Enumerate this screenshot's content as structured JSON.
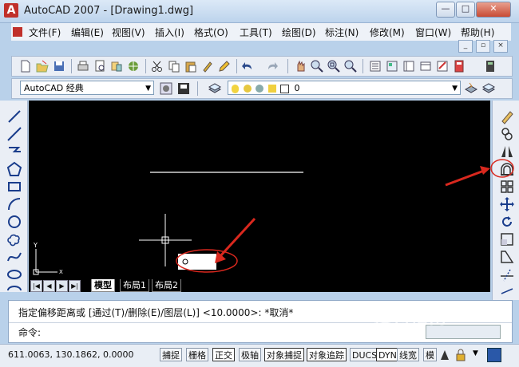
{
  "window": {
    "title": "AutoCAD 2007 - [Drawing1.dwg]",
    "logo_glyph": "A",
    "minimize_label": "—",
    "maximize_label": "□",
    "close_label": "✕"
  },
  "menu": {
    "items": [
      {
        "label": "文件(F)"
      },
      {
        "label": "编辑(E)"
      },
      {
        "label": "视图(V)"
      },
      {
        "label": "插入(I)"
      },
      {
        "label": "格式(O)"
      },
      {
        "label": "工具(T)"
      },
      {
        "label": "绘图(D)"
      },
      {
        "label": "标注(N)"
      },
      {
        "label": "修改(M)"
      },
      {
        "label": "窗口(W)"
      },
      {
        "label": "帮助(H)"
      }
    ],
    "mdi": {
      "minimize": "_",
      "restore": "▫",
      "close": "×"
    }
  },
  "toolbar": {
    "workspace_value": "AutoCAD 经典",
    "layer_value": "0"
  },
  "canvas": {
    "ucs_y": "Y",
    "ucs_x": "X"
  },
  "tabs": {
    "items": [
      {
        "label": "模型"
      },
      {
        "label": "布局1"
      },
      {
        "label": "布局2"
      }
    ]
  },
  "command": {
    "history": "指定偏移距离或 [通过(T)/删除(E)/图层(L)] <10.0000>:  *取消*",
    "prompt": "命令:"
  },
  "status": {
    "coordinates": "611.0063,  130.1862, 0.0000",
    "toggles": [
      {
        "label": "捕捉",
        "on": false
      },
      {
        "label": "栅格",
        "on": false
      },
      {
        "label": "正交",
        "on": true
      },
      {
        "label": "极轴",
        "on": false
      },
      {
        "label": "对象捕捉",
        "on": true
      },
      {
        "label": "对象追踪",
        "on": true
      },
      {
        "label": "DUCS",
        "on": false
      },
      {
        "label": "DYN",
        "on": true
      },
      {
        "label": "线宽",
        "on": false
      },
      {
        "label": "模",
        "on": false
      }
    ]
  },
  "watermark": "搜狗指南",
  "colors": {
    "annotation_red": "#d9281e",
    "canvas_bg": "#000000"
  }
}
